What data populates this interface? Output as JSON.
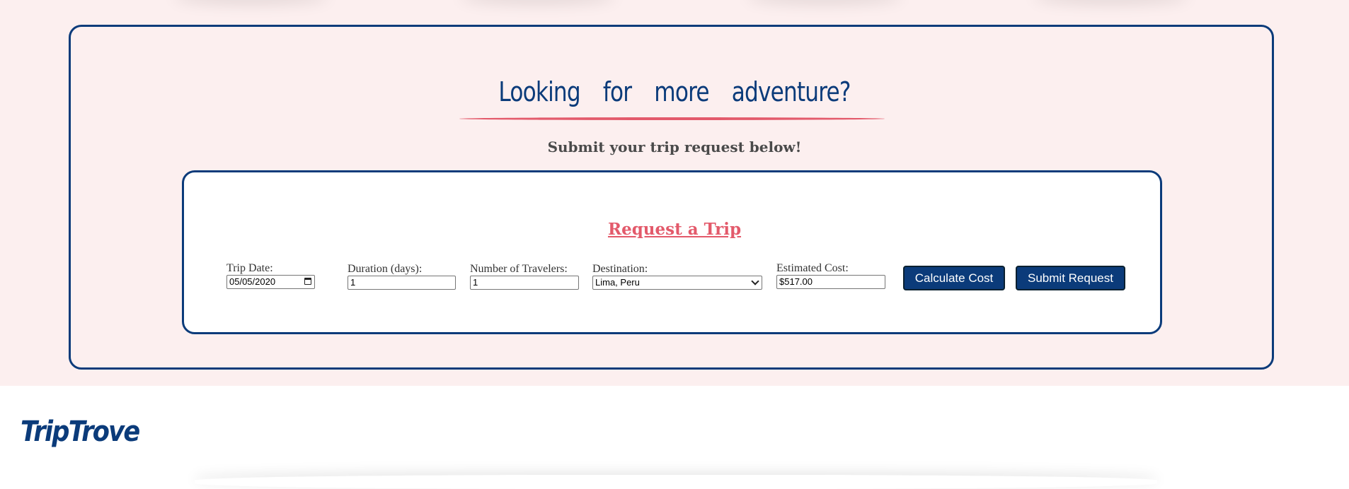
{
  "section": {
    "headline": "Looking for more adventure?",
    "subheading": "Submit your trip request below!"
  },
  "form": {
    "title": "Request a Trip",
    "trip_date": {
      "label": "Trip Date:",
      "value": "05/05/2020"
    },
    "duration": {
      "label": "Duration (days):",
      "value": "1"
    },
    "travelers": {
      "label": "Number of Travelers:",
      "value": "1"
    },
    "destination": {
      "label": "Destination:",
      "selected": "Lima, Peru"
    },
    "estimated_cost": {
      "label": "Estimated Cost:",
      "value": "$517.00"
    },
    "calculate_label": "Calculate Cost",
    "submit_label": "Submit Request"
  },
  "footer": {
    "brand": "TripTrove"
  },
  "colors": {
    "navy": "#0b3b7a",
    "accent_pink": "#e35a6b",
    "section_bg": "#fcefef"
  }
}
